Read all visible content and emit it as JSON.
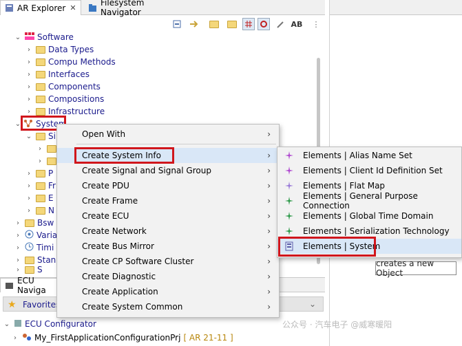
{
  "tabs": [
    {
      "label": "AR Explorer",
      "close": "✕"
    },
    {
      "label": "Filesystem Navigator"
    }
  ],
  "toolbar": {
    "ab_label": "AB"
  },
  "tree": {
    "software": "Software",
    "children": [
      "Data Types",
      "Compu Methods",
      "Interfaces",
      "Components",
      "Compositions",
      "Infrastructure"
    ],
    "system": "System",
    "system_children_partial": [
      "Si",
      "S",
      "S",
      "P",
      "Fr",
      "E",
      "N"
    ],
    "lower": [
      "Bsw",
      "Varia",
      "Timi",
      "Stan",
      "S"
    ]
  },
  "context_menu": {
    "items": [
      {
        "label": "Open With",
        "arrow": "›"
      },
      {
        "label": "Create System Info",
        "arrow": "›"
      },
      {
        "label": "Create Signal and Signal Group",
        "arrow": "›"
      },
      {
        "label": "Create PDU",
        "arrow": "›"
      },
      {
        "label": "Create Frame",
        "arrow": "›"
      },
      {
        "label": "Create ECU",
        "arrow": "›"
      },
      {
        "label": "Create Network",
        "arrow": "›"
      },
      {
        "label": "Create Bus Mirror",
        "arrow": "›"
      },
      {
        "label": "Create CP Software Cluster",
        "arrow": "›"
      },
      {
        "label": "Create Diagnostic",
        "arrow": "›"
      },
      {
        "label": "Create Application",
        "arrow": "›"
      },
      {
        "label": "Create System Common",
        "arrow": "›"
      }
    ]
  },
  "submenu": {
    "items": [
      {
        "label": "Elements | Alias Name Set",
        "icon": "sparkle-icon",
        "color": "#b04ad0"
      },
      {
        "label": "Elements | Client Id Definition Set",
        "icon": "sparkle-icon",
        "color": "#b04ad0"
      },
      {
        "label": "Elements | Flat Map",
        "icon": "sparkle-icon",
        "color": "#b04ad0"
      },
      {
        "label": "Elements | General Purpose Connection",
        "icon": "sparkle-icon",
        "color": "#2e9a4a"
      },
      {
        "label": "Elements | Global Time Domain",
        "icon": "sparkle-icon",
        "color": "#2e9a4a"
      },
      {
        "label": "Elements | Serialization Technology",
        "icon": "sparkle-icon",
        "color": "#2e9a4a"
      },
      {
        "label": "Elements | System",
        "icon": "system-icon",
        "color": "#5a5aa8"
      }
    ]
  },
  "tooltip": "creates a new Object",
  "bottom": {
    "ecu_nav": "ECU Naviga",
    "favorites": "Favorites",
    "ecu_configurator": "ECU Configurator",
    "project": "My_FirstApplicationConfigurationPrj",
    "project_tag": "[ AR 21-11 ]"
  },
  "watermark": "公众号 · 汽车电子 @威寒暖阳",
  "accent": "#d0161c"
}
